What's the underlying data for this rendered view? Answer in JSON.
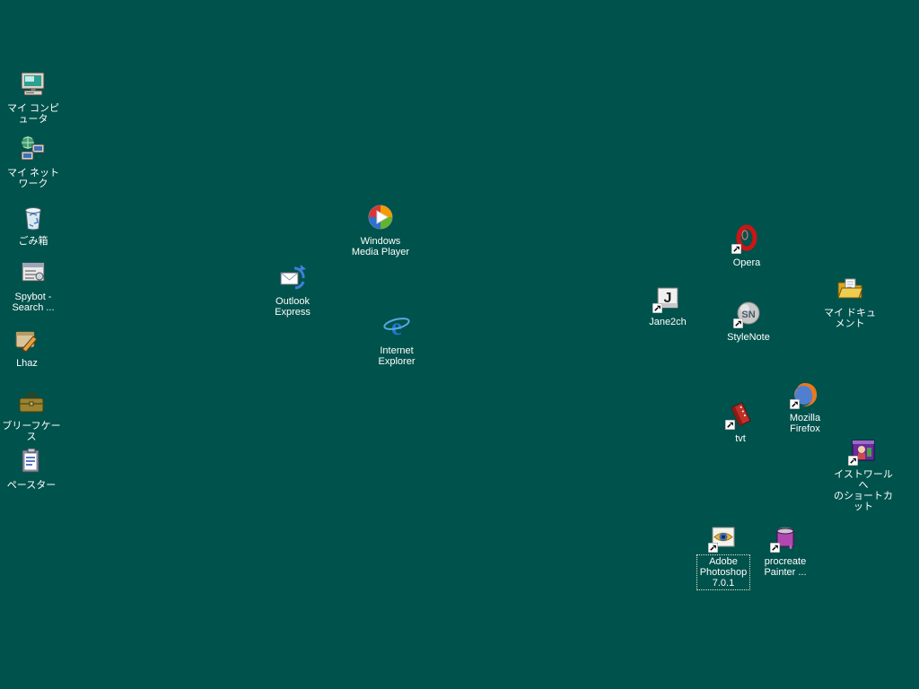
{
  "desktop": {
    "background_color": "#00524c",
    "os_style": "windows-classic-teal-desktop",
    "icons": [
      {
        "id": "my-computer",
        "icon": "my-computer-icon",
        "label": "マイ コンピュータ",
        "selected": false
      },
      {
        "id": "my-network",
        "icon": "my-network-icon",
        "label": "マイ ネットワーク",
        "selected": false
      },
      {
        "id": "recycle-bin",
        "icon": "recycle-bin-icon",
        "label": "ごみ箱",
        "selected": false
      },
      {
        "id": "spybot",
        "icon": "spybot-icon",
        "label": "Spybot -\nSearch ...",
        "selected": false
      },
      {
        "id": "lhaz",
        "icon": "lhaz-icon",
        "label": "Lhaz",
        "selected": false
      },
      {
        "id": "briefcase",
        "icon": "briefcase-icon",
        "label": "ブリーフケース",
        "selected": false
      },
      {
        "id": "paster",
        "icon": "paster-icon",
        "label": "ペースター",
        "selected": false
      },
      {
        "id": "windows-media-player",
        "icon": "windows-media-player-icon",
        "label": "Windows\nMedia Player",
        "selected": false
      },
      {
        "id": "outlook-express",
        "icon": "outlook-express-icon",
        "label": "Outlook\nExpress",
        "selected": false
      },
      {
        "id": "internet-explorer",
        "icon": "internet-explorer-icon",
        "label": "Internet\nExplorer",
        "selected": false
      },
      {
        "id": "opera",
        "icon": "opera-icon",
        "label": "Opera",
        "selected": false
      },
      {
        "id": "jane2ch",
        "icon": "jane2ch-icon",
        "label": "Jane2ch",
        "selected": false
      },
      {
        "id": "stylenote",
        "icon": "stylenote-icon",
        "label": "StyleNote",
        "selected": false
      },
      {
        "id": "my-documents",
        "icon": "my-documents-icon",
        "label": "マイ ドキュメント",
        "selected": false
      },
      {
        "id": "tvt",
        "icon": "tvt-icon",
        "label": "tvt",
        "selected": false
      },
      {
        "id": "firefox",
        "icon": "firefox-icon",
        "label": "Mozilla\nFirefox",
        "selected": false
      },
      {
        "id": "istoire-shortcut",
        "icon": "istoire-game-icon",
        "label": "イストワールへ\nのショートカット",
        "selected": false
      },
      {
        "id": "photoshop",
        "icon": "photoshop-icon",
        "label": "Adobe\nPhotoshop\n7.0.1",
        "selected": true
      },
      {
        "id": "painter",
        "icon": "painter-icon",
        "label": "procreate\nPainter ...",
        "selected": false
      }
    ]
  }
}
